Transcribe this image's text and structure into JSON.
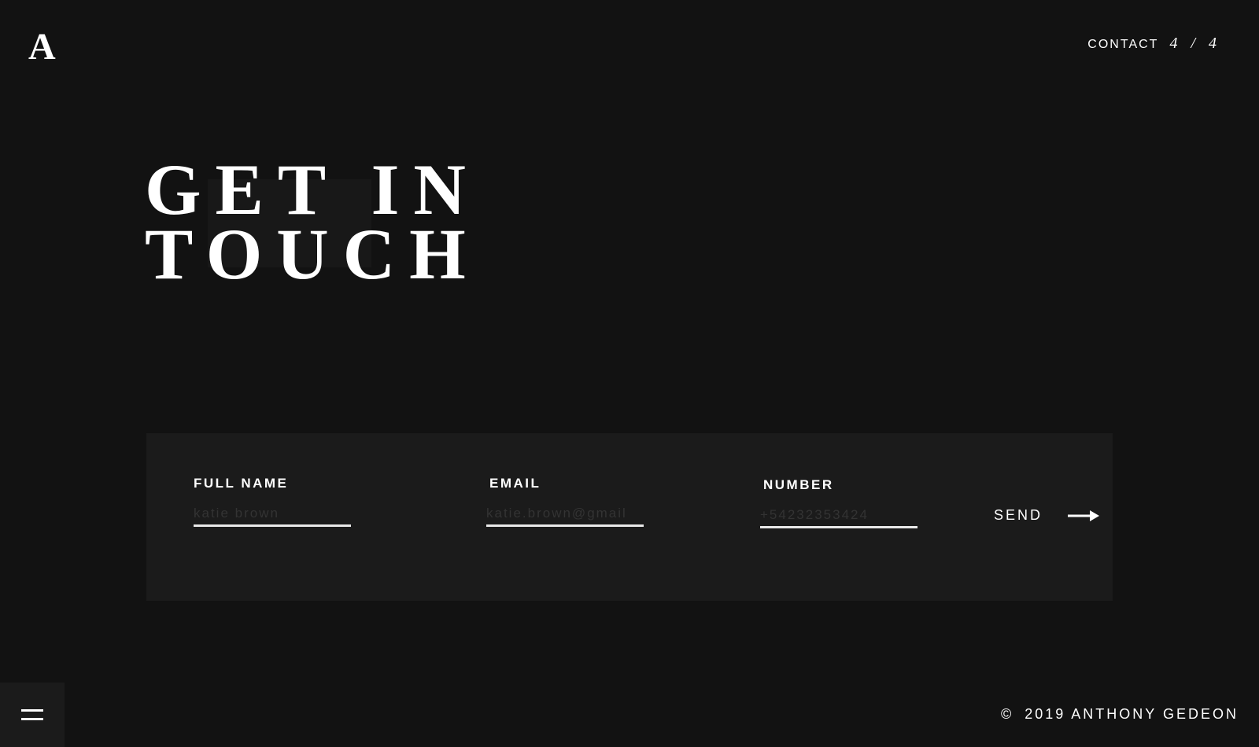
{
  "header": {
    "logo": "A",
    "section_label": "CONTACT",
    "pager": "4 / 4"
  },
  "hero": {
    "line1": "GET IN",
    "line2": "TOUCH"
  },
  "form": {
    "full_name": {
      "label": "FULL NAME",
      "placeholder": "katie brown"
    },
    "email": {
      "label": "EMAIL",
      "placeholder": "katie.brown@gmail"
    },
    "number": {
      "label": "NUMBER",
      "placeholder": "+54232353424"
    },
    "send_label": "SEND"
  },
  "footer": {
    "copyright_symbol": "©",
    "text": "2019 ANTHONY GEDEON"
  },
  "icons": {
    "send": "arrow-right-icon",
    "menu": "hamburger-menu-icon"
  },
  "colors": {
    "background": "#121212",
    "panel": "#1b1b1b",
    "text": "#ffffff",
    "placeholder": "#333333"
  }
}
